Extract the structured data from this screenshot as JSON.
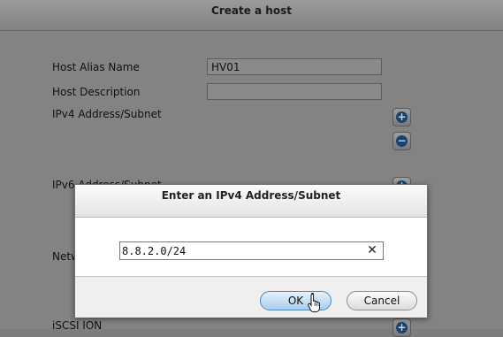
{
  "background_dialog": {
    "title": "Create a host",
    "fields": {
      "alias_label": "Host Alias Name",
      "alias_value": "HV01",
      "description_label": "Host Description",
      "description_value": "",
      "ipv4_label": "IPv4 Address/Subnet",
      "ipv6_label": "IPv6 Address/Subnet",
      "network_label": "Netw",
      "iscsi_label": "iSCSI ION"
    },
    "add_glyph": "+",
    "remove_glyph": "−"
  },
  "modal": {
    "title": "Enter an IPv4 Address/Subnet",
    "input_value": "8.8.2.0/24",
    "clear_glyph": "✕",
    "ok_label": "OK",
    "cancel_label": "Cancel"
  },
  "icons": {
    "cursor": "hand-pointer-icon"
  }
}
